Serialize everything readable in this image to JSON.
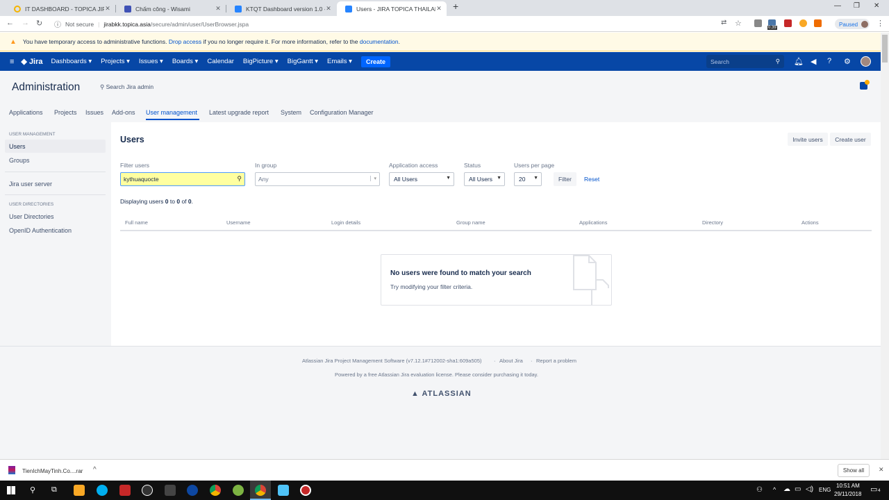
{
  "browser": {
    "tabs": [
      {
        "title": "IT DASHBOARD - TOPICA JIRA",
        "color": "#f4b400",
        "active": false
      },
      {
        "title": "Chấm công - Wisami",
        "color": "#3f51b5",
        "active": false
      },
      {
        "title": "KTQT Dashboard version 1.0 - JIR",
        "color": "#2684ff",
        "active": false
      },
      {
        "title": "Users - JIRA TOPICA THAILAND",
        "color": "#2684ff",
        "active": true
      }
    ],
    "security": "Not secure",
    "url_host": "jirabkk.topica.asia",
    "url_path": "/secure/admin/user/UserBrowser.jspa",
    "paused": "Paused",
    "ext_badge": "0.39"
  },
  "warning": {
    "text_before": "You have temporary access to administrative functions.",
    "drop_link": "Drop access",
    "text_mid": "if you no longer require it. For more information, refer to the",
    "doc_link": "documentation",
    "text_end": "."
  },
  "header": {
    "logo": "Jira",
    "nav": [
      "Dashboards",
      "Projects",
      "Issues",
      "Boards",
      "Calendar",
      "BigPicture",
      "BigGantt",
      "Emails"
    ],
    "nav_dropdown": [
      true,
      true,
      true,
      true,
      false,
      true,
      true,
      true
    ],
    "create": "Create",
    "search_placeholder": "Search"
  },
  "admin": {
    "title": "Administration",
    "search": "Search Jira admin",
    "tabs": [
      "Applications",
      "Projects",
      "Issues",
      "Add-ons",
      "User management",
      "Latest upgrade report",
      "System",
      "Configuration Manager"
    ],
    "active_tab": "User management"
  },
  "sidebar": {
    "section1": "USER MANAGEMENT",
    "items1": [
      "Users",
      "Groups"
    ],
    "server": "Jira user server",
    "section2": "USER DIRECTORIES",
    "items2": [
      "User Directories",
      "OpenID Authentication"
    ]
  },
  "main": {
    "title": "Users",
    "invite": "Invite users",
    "create_user": "Create user",
    "filters": {
      "filter_users_label": "Filter users",
      "filter_users_value": "kythuaquocte",
      "in_group_label": "In group",
      "in_group_value": "Any",
      "app_access_label": "Application access",
      "app_access_value": "All Users",
      "status_label": "Status",
      "status_value": "All Users",
      "per_page_label": "Users per page",
      "per_page_value": "20",
      "filter_btn": "Filter",
      "reset": "Reset"
    },
    "displaying": {
      "prefix": "Displaying users",
      "from": "0",
      "to_word": "to",
      "to": "0",
      "of_word": "of",
      "total": "0",
      "suffix": "."
    },
    "columns": [
      "Full name",
      "Username",
      "Login details",
      "Group name",
      "Applications",
      "Directory",
      "Actions"
    ],
    "empty_title": "No users were found to match your search",
    "empty_sub": "Try modifying your filter criteria."
  },
  "footer": {
    "line1_a": "Atlassian Jira Project Management Software (v7.12.1#712002-sha1:609a505)",
    "line1_b": "About Jira",
    "line1_c": "Report a problem",
    "line2": "Powered by a free Atlassian Jira evaluation license. Please consider purchasing it today.",
    "brand": "ATLASSIAN"
  },
  "download": {
    "file": "TienIchMayTinh.Co....rar",
    "show_all": "Show all"
  },
  "taskbar": {
    "lang": "ENG",
    "time": "10:51 AM",
    "date": "29/11/2018",
    "notif_count": "4"
  }
}
